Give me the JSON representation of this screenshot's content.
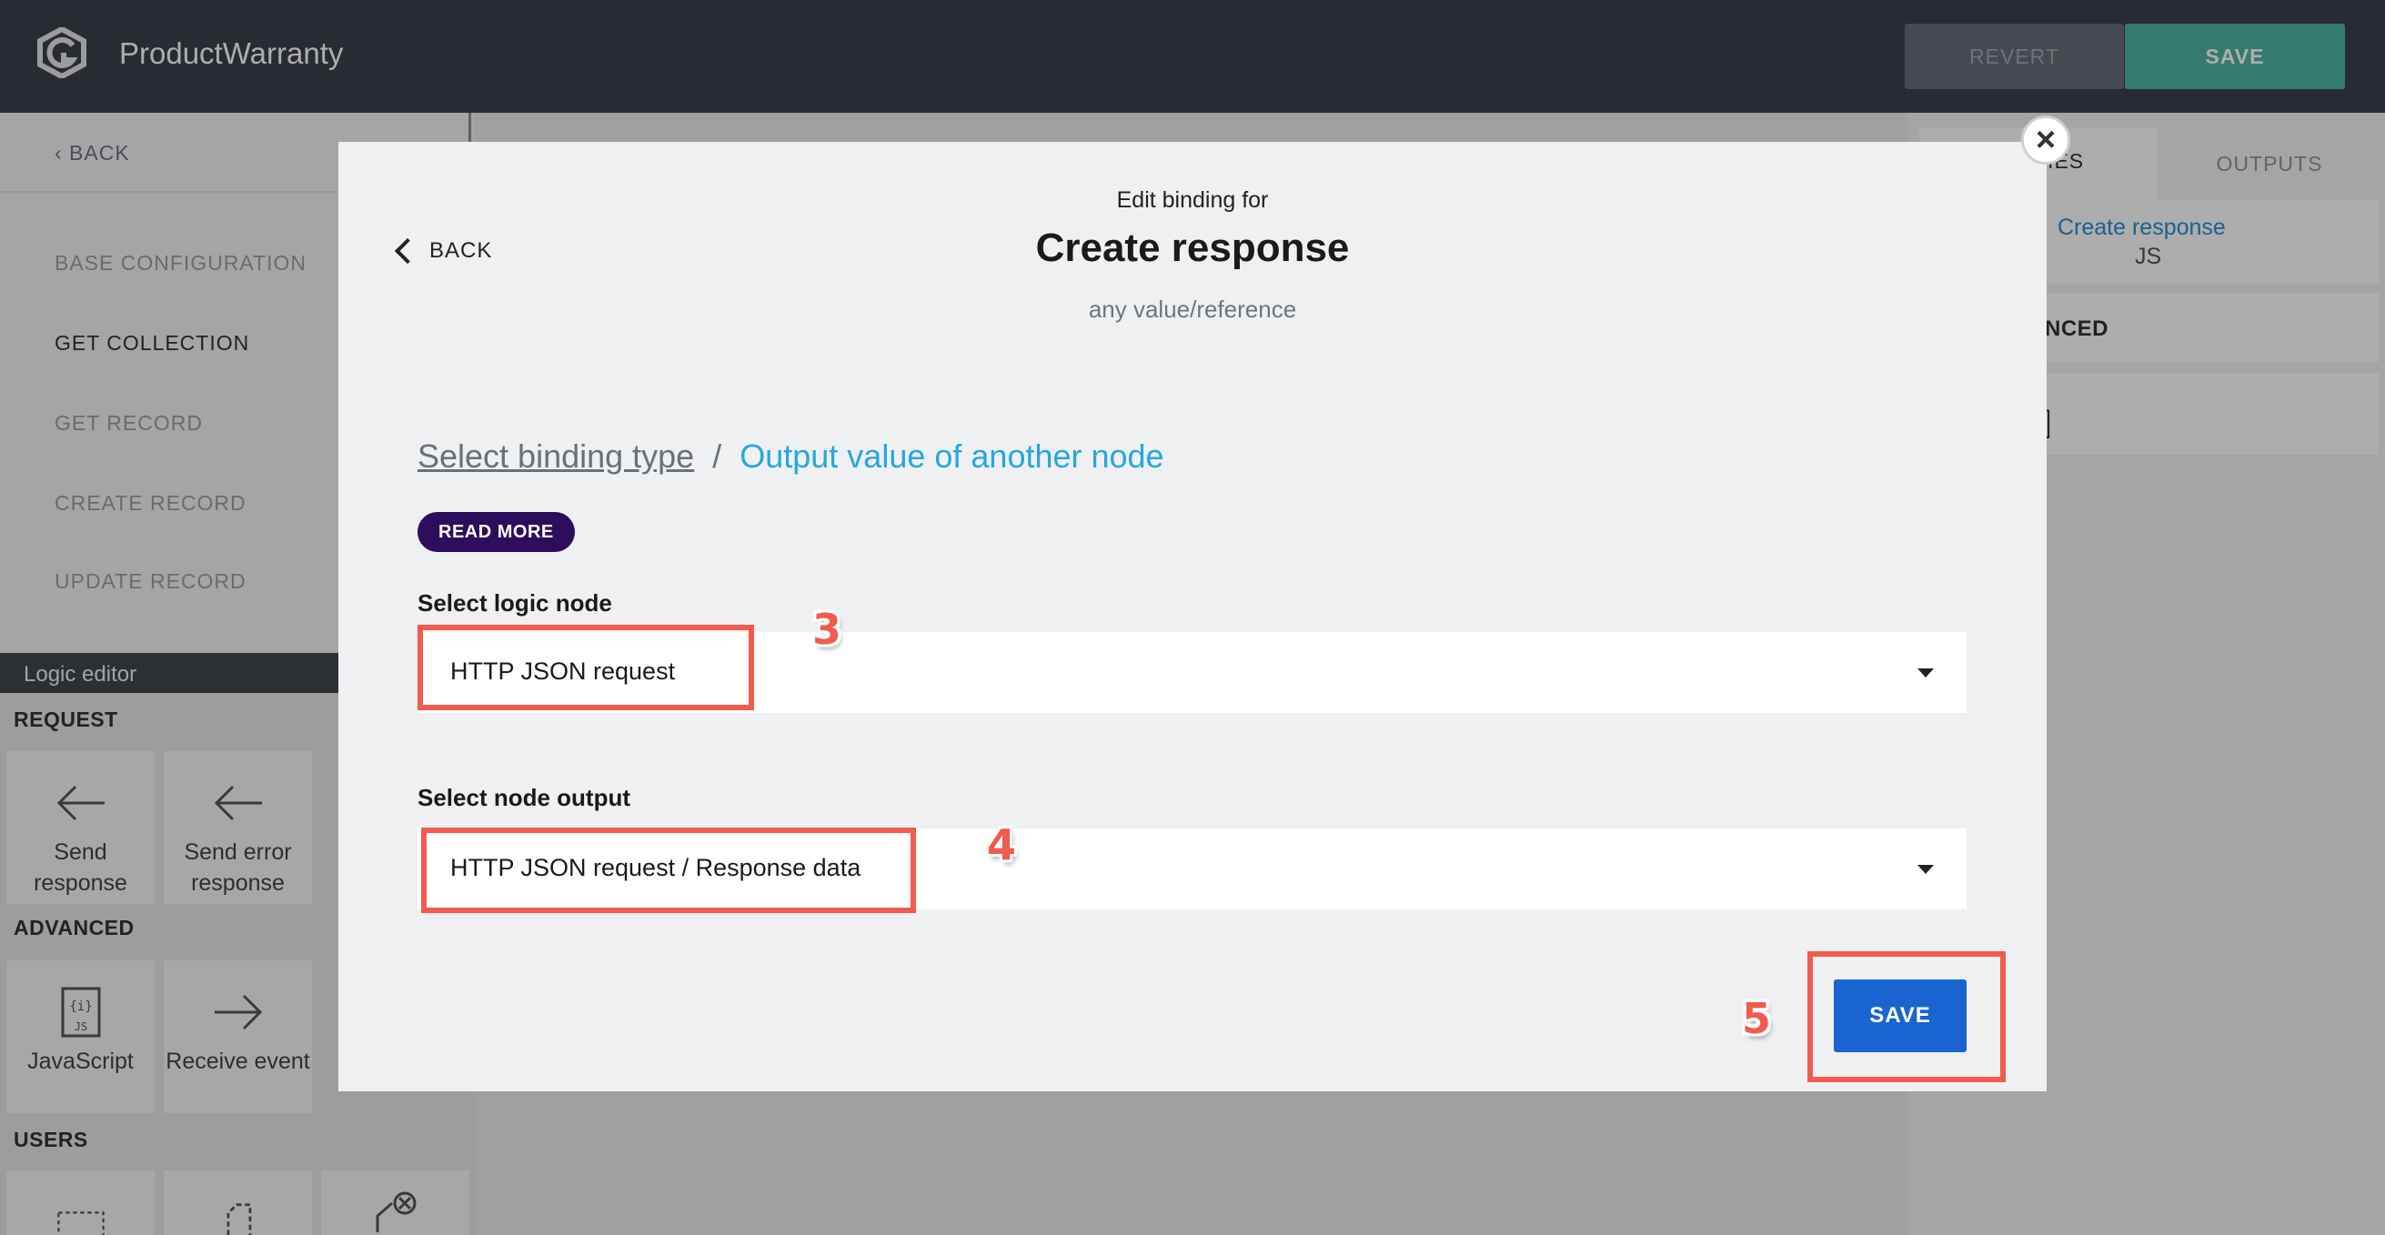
{
  "app": {
    "title": "ProductWarranty",
    "revert_label": "REVERT",
    "save_label": "SAVE"
  },
  "left_nav": {
    "back_label": "‹ BACK",
    "items": [
      {
        "label": "BASE CONFIGURATION"
      },
      {
        "label": "GET COLLECTION"
      },
      {
        "label": "GET RECORD"
      },
      {
        "label": "CREATE RECORD"
      },
      {
        "label": "UPDATE RECORD"
      }
    ]
  },
  "logic_editor": {
    "header": "Logic editor",
    "sections": {
      "request": "REQUEST",
      "advanced": "ADVANCED",
      "users": "USERS"
    },
    "tiles": {
      "send_response": "Send response",
      "send_error_response": "Send error response",
      "javascript": "JavaScript",
      "receive_event": "Receive event"
    }
  },
  "right_panel": {
    "tab_properties_partial": "TIES",
    "tab_outputs": "OUTPUTS",
    "binding_link": "Create response",
    "binding_type": "JS",
    "advanced_partial": "NCED"
  },
  "modal": {
    "edit_label": "Edit binding for",
    "title": "Create response",
    "hint": "any value/reference",
    "back_label": "BACK",
    "breadcrumb": {
      "root": "Select binding type",
      "separator": "/",
      "current": "Output value of another node"
    },
    "read_more": "READ MORE",
    "logic_node_label": "Select logic node",
    "logic_node_value": "HTTP JSON request",
    "node_output_label": "Select node output",
    "node_output_value": "HTTP JSON request / Response data",
    "save_label": "SAVE",
    "close_icon": "close-icon"
  },
  "annotations": {
    "step3": "3",
    "step4": "4",
    "step5": "5",
    "highlight_color": "#f25b4d"
  },
  "colors": {
    "topbar": "#3b414b",
    "save_top": "#4fb4a4",
    "primary": "#1a64d2",
    "link": "#27a6e0",
    "read_more": "#2c0e5c"
  }
}
